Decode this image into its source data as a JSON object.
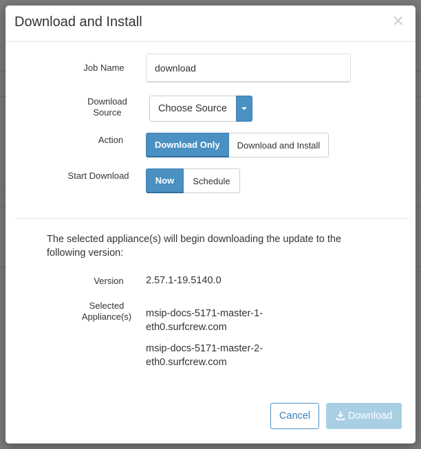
{
  "dialog": {
    "title": "Download and Install",
    "close_glyph": "×"
  },
  "form": {
    "job_name": {
      "label": "Job Name",
      "value": "download"
    },
    "download_source": {
      "label_line1": "Download",
      "label_line2": "Source",
      "selected": "Choose Source"
    },
    "action": {
      "label": "Action",
      "options": [
        "Download Only",
        "Download and Install"
      ],
      "selected": "Download Only"
    },
    "start_download": {
      "label": "Start Download",
      "options": [
        "Now",
        "Schedule"
      ],
      "selected": "Now"
    }
  },
  "info": {
    "message": "The selected appliance(s) will begin downloading the update to the following version:",
    "version_label": "Version",
    "version_value": "2.57.1-19.5140.0",
    "appliances_label_line1": "Selected",
    "appliances_label_line2": "Appliance(s)",
    "appliances": [
      {
        "line1": "msip-docs-5171-master-1-",
        "line2": "eth0.surfcrew.com"
      },
      {
        "line1": "msip-docs-5171-master-2-",
        "line2": "eth0.surfcrew.com"
      }
    ]
  },
  "footer": {
    "cancel_label": "Cancel",
    "download_label": "Download",
    "download_icon": "download-icon"
  },
  "colors": {
    "primary": "#4a90c2",
    "primary_disabled": "#a9cfe4",
    "overlay": "#6f6f6f"
  }
}
